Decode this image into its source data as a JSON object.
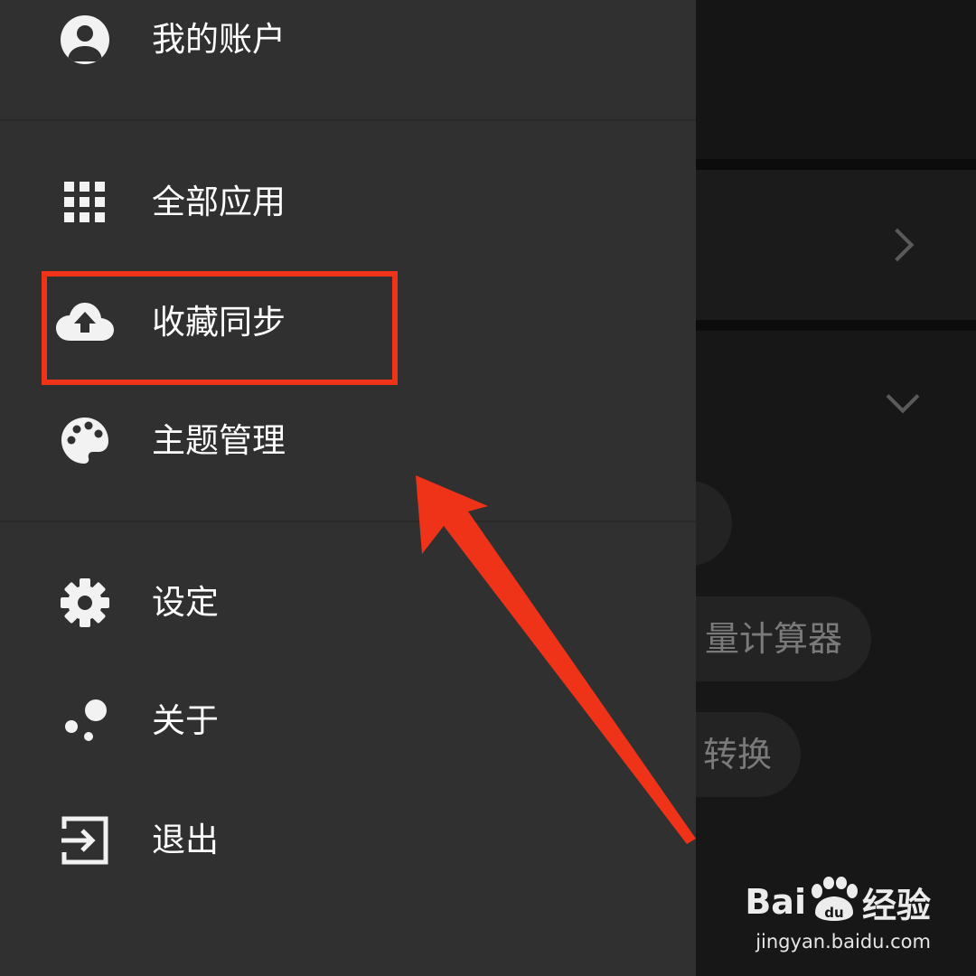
{
  "drawer": {
    "account": {
      "icon": "account-circle-icon",
      "label": "我的账户"
    },
    "items": [
      {
        "icon": "apps-grid-icon",
        "label": "全部应用"
      },
      {
        "icon": "cloud-upload-icon",
        "label": "收藏同步"
      },
      {
        "icon": "palette-icon",
        "label": "主题管理"
      },
      {
        "icon": "gear-icon",
        "label": "设定"
      },
      {
        "icon": "bubbles-icon",
        "label": "关于"
      },
      {
        "icon": "exit-icon",
        "label": "退出"
      }
    ]
  },
  "background": {
    "pills": [
      "量计算器",
      "转换"
    ]
  },
  "annotation": {
    "highlight_color": "#ee3318",
    "arrow_color": "#ee3318"
  },
  "watermark": {
    "logo_prefix": "Bai",
    "logo_suffix": "经验",
    "url": "jingyan.baidu.com"
  },
  "colors": {
    "drawer_bg": "#303030",
    "overlay_bg": "#161616",
    "text": "#ffffff"
  }
}
